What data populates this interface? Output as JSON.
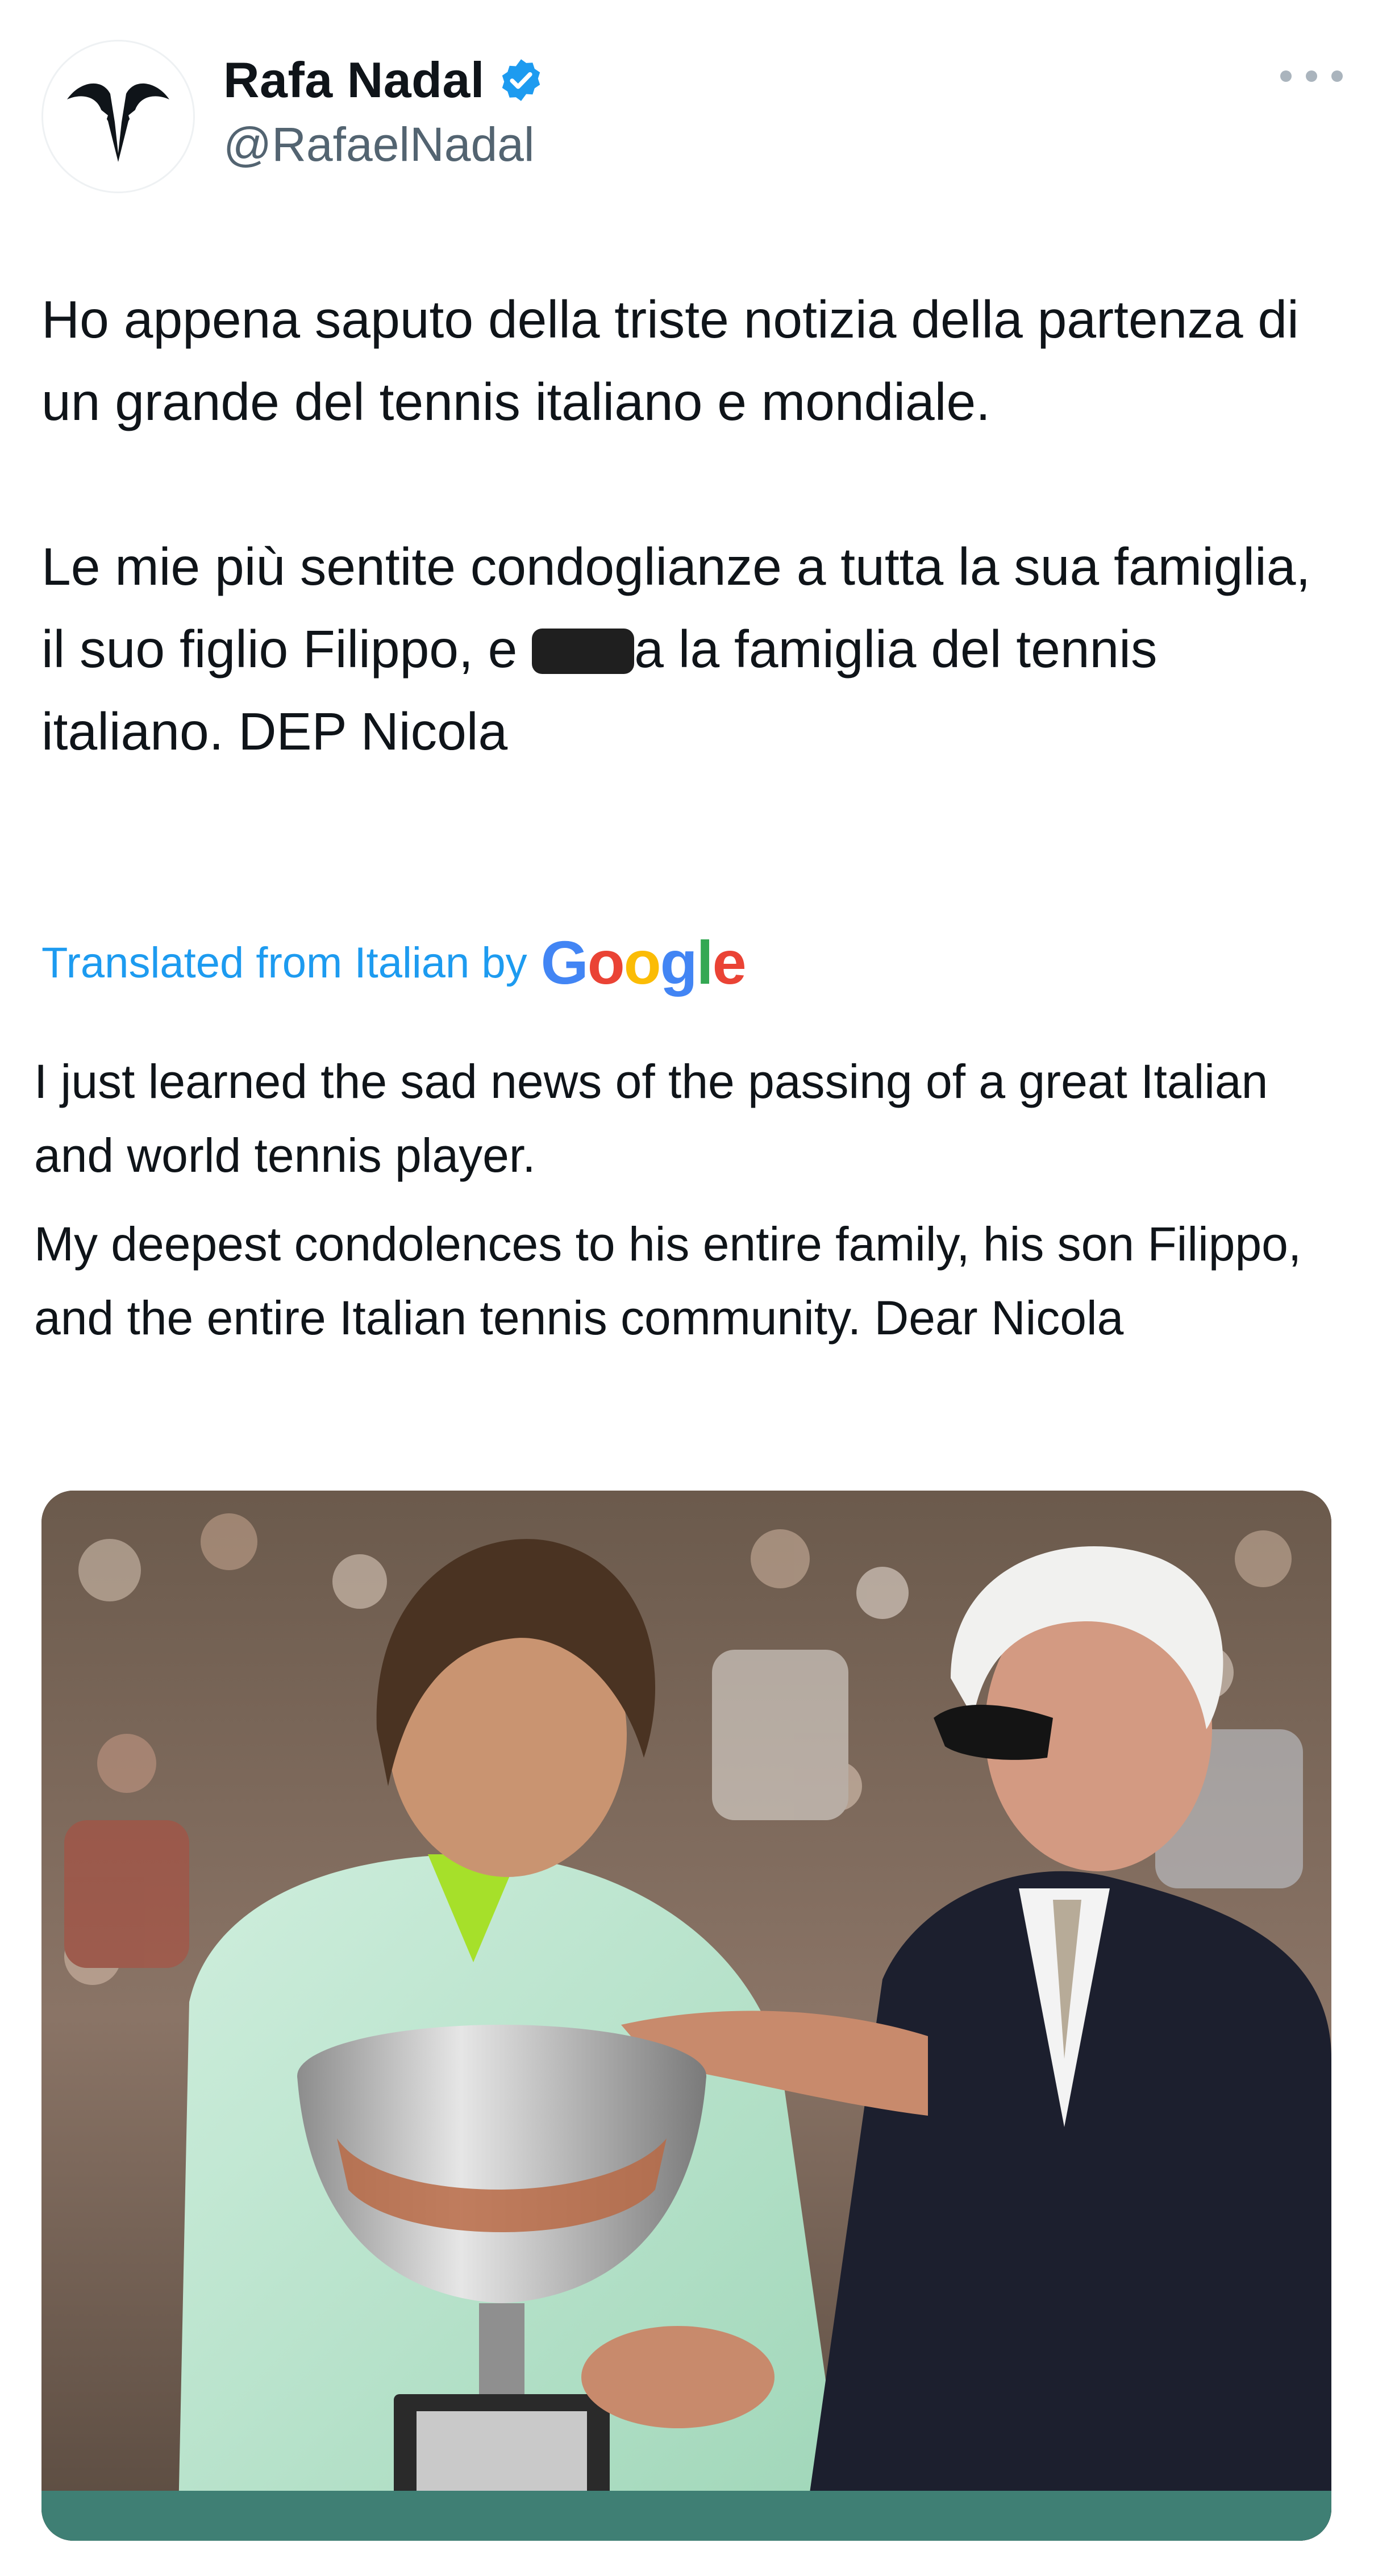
{
  "author": {
    "display_name": "Rafa Nadal",
    "handle": "@RafaelNadal",
    "verified": true,
    "avatar_icon": "rafa-bull-logo-icon"
  },
  "more_menu": {
    "icon": "more-horizontal-icon"
  },
  "tweet": {
    "paragraph_1": "Ho appena saputo della triste notizia della partenza di un grande del tennis italiano e mondiale.",
    "paragraph_2_before": "Le mie più sentite condoglianze a tutta la sua famiglia, il suo figlio Filippo, e ",
    "paragraph_2_after": "a la famiglia del tennis italiano. DEP Nicola"
  },
  "translation": {
    "label": "Translated from Italian by",
    "provider": "Google",
    "paragraph_1": "I just learned the sad news of the passing of a great Italian and world tennis player.",
    "paragraph_2": "My deepest condolences to his entire family, his son Filippo, and the entire Italian tennis community. Dear Nicola"
  },
  "media": {
    "type": "photo",
    "subject": "trophy-presentation-photo"
  },
  "colors": {
    "text_primary": "#0f1419",
    "text_secondary": "#536471",
    "link": "#1d9bf0",
    "verified": "#1d9bf0"
  }
}
